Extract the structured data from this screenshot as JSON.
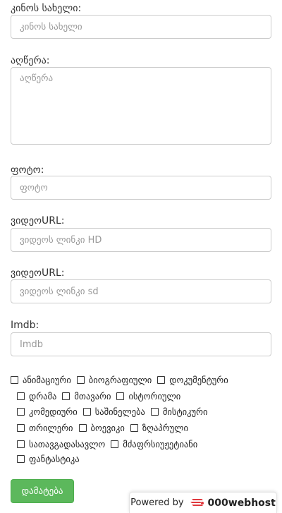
{
  "form": {
    "name": {
      "label": "კინოს სახელი:",
      "placeholder": "კინოს სახელი"
    },
    "description": {
      "label": "აღწერა:",
      "placeholder": "აღწერა"
    },
    "photo": {
      "label": "ფოტო:",
      "placeholder": "ფოტო"
    },
    "video_hd": {
      "label": "ვიდეოURL:",
      "placeholder": "ვიდეოს ლინკი HD"
    },
    "video_sd": {
      "label": "ვიდეოURL:",
      "placeholder": "ვიდეოს ლინკი sd"
    },
    "imdb": {
      "label": "Imdb:",
      "placeholder": "Imdb"
    }
  },
  "genres": [
    "ანიმაციური",
    "ბიოგრაფიული",
    "დოკუმენტური",
    "დრამა",
    "მთავარი",
    "ისტორიული",
    "კომედიური",
    "საშინელება",
    "მისტიკური",
    "თრილერი",
    "ბოევიკი",
    "ზღაპრული",
    "სათავგადასავლო",
    "მძაფრსიუჟეტიანი",
    "ფანტასტიკა"
  ],
  "submit_label": "დამატება",
  "footer": {
    "powered_by": "Powered by",
    "brand": "000webhost"
  },
  "colors": {
    "button": "#5cb85c",
    "logo": "#e0393e"
  }
}
